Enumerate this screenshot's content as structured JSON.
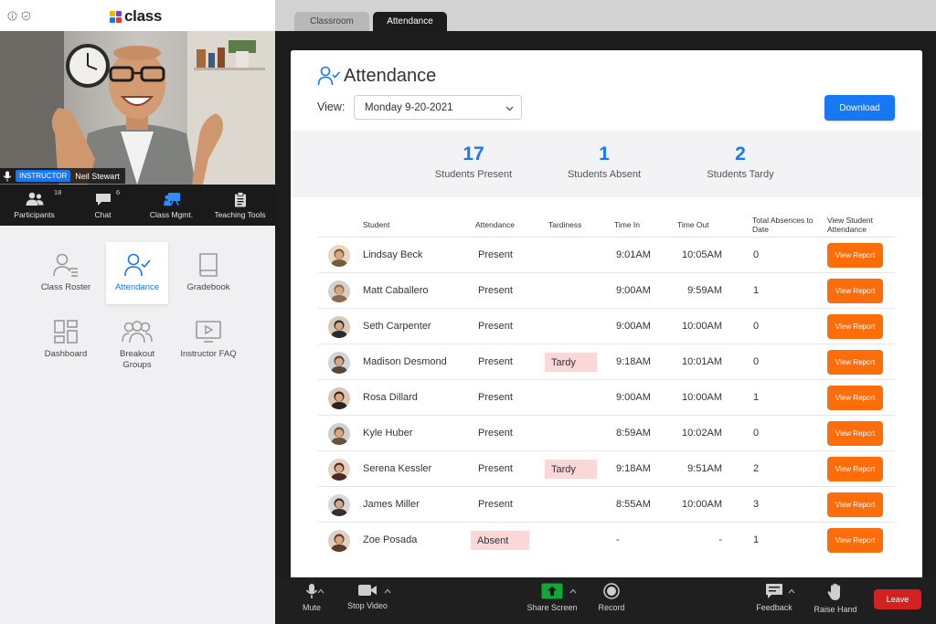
{
  "app": {
    "brand": "class",
    "brand_colors": [
      "#f5b800",
      "#7b3fd6",
      "#1877f2",
      "#e53935"
    ]
  },
  "video": {
    "role_badge": "INSTRUCTOR",
    "name": "Neil Stewart"
  },
  "controls": [
    {
      "label": "Participants",
      "icon": "participants-icon",
      "count": "18"
    },
    {
      "label": "Chat",
      "icon": "chat-icon",
      "count": "6"
    },
    {
      "label": "Class Mgmt.",
      "icon": "class-mgmt-icon"
    },
    {
      "label": "Teaching Tools",
      "icon": "teaching-tools-icon"
    }
  ],
  "apps": [
    {
      "label": "Class Roster",
      "icon": "class-roster-icon"
    },
    {
      "label": "Attendance",
      "icon": "attendance-icon",
      "active": true
    },
    {
      "label": "Gradebook",
      "icon": "gradebook-icon"
    },
    {
      "label": "Dashboard",
      "icon": "dashboard-icon"
    },
    {
      "label": "Breakout Groups",
      "icon": "breakout-groups-icon"
    },
    {
      "label": "Instructor FAQ",
      "icon": "instructor-faq-icon"
    }
  ],
  "tabs": [
    "Classroom",
    "Attendance"
  ],
  "attendance": {
    "title": "Attendance",
    "view_label": "View:",
    "view_value": "Monday 9-20-2021",
    "download_label": "Download",
    "stats": [
      {
        "value": "17",
        "label": "Students Present"
      },
      {
        "value": "1",
        "label": "Students Absent"
      },
      {
        "value": "2",
        "label": "Students Tardy"
      }
    ],
    "columns": [
      "Student",
      "Attendance",
      "Tardiness",
      "Time In",
      "Time Out",
      "Total Absences to Date",
      "View Student Attendance"
    ],
    "view_report_label": "View Report",
    "rows": [
      {
        "name": "Lindsay Beck",
        "attendance": "Present",
        "tardiness": "",
        "time_in": "9:01AM",
        "time_out": "10:05AM",
        "absences": "0"
      },
      {
        "name": "Matt Caballero",
        "attendance": "Present",
        "tardiness": "",
        "time_in": "9:00AM",
        "time_out": "9:59AM",
        "absences": "1"
      },
      {
        "name": "Seth Carpenter",
        "attendance": "Present",
        "tardiness": "",
        "time_in": "9:00AM",
        "time_out": "10:00AM",
        "absences": "0"
      },
      {
        "name": "Madison Desmond",
        "attendance": "Present",
        "tardiness": "Tardy",
        "time_in": "9:18AM",
        "time_out": "10:01AM",
        "absences": "0"
      },
      {
        "name": "Rosa Dillard",
        "attendance": "Present",
        "tardiness": "",
        "time_in": "9:00AM",
        "time_out": "10:00AM",
        "absences": "1"
      },
      {
        "name": "Kyle Huber",
        "attendance": "Present",
        "tardiness": "",
        "time_in": "8:59AM",
        "time_out": "10:02AM",
        "absences": "0"
      },
      {
        "name": "Serena Kessler",
        "attendance": "Present",
        "tardiness": "Tardy",
        "time_in": "9:18AM",
        "time_out": "9:51AM",
        "absences": "2"
      },
      {
        "name": "James Miller",
        "attendance": "Present",
        "tardiness": "",
        "time_in": "8:55AM",
        "time_out": "10:00AM",
        "absences": "3"
      },
      {
        "name": "Zoe Posada",
        "attendance": "Absent",
        "tardiness": "",
        "time_in": "-",
        "time_out": "-",
        "absences": "1"
      }
    ]
  },
  "bottom_bar": {
    "mute": "Mute",
    "stop_video": "Stop Video",
    "share_screen": "Share Screen",
    "record": "Record",
    "feedback": "Feedback",
    "raise_hand": "Raise Hand",
    "leave": "Leave"
  }
}
